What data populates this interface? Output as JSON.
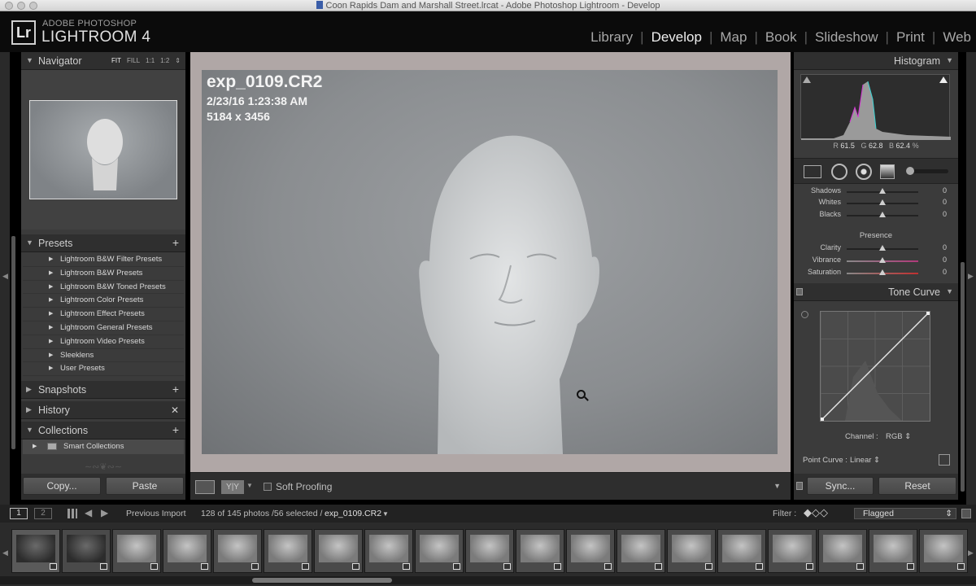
{
  "window": {
    "title": "Coon Rapids Dam and Marshall Street.lrcat - Adobe Photoshop Lightroom - Develop"
  },
  "brand": {
    "logo": "Lr",
    "line1": "ADOBE PHOTOSHOP",
    "line2": "LIGHTROOM 4"
  },
  "modules": [
    {
      "label": "Library",
      "active": false
    },
    {
      "label": "Develop",
      "active": true
    },
    {
      "label": "Map",
      "active": false
    },
    {
      "label": "Book",
      "active": false
    },
    {
      "label": "Slideshow",
      "active": false
    },
    {
      "label": "Print",
      "active": false
    },
    {
      "label": "Web",
      "active": false
    }
  ],
  "navigator": {
    "title": "Navigator",
    "zoom": [
      "FIT",
      "FILL",
      "1:1",
      "1:2"
    ]
  },
  "presets": {
    "title": "Presets",
    "items": [
      "Lightroom B&W Filter Presets",
      "Lightroom B&W Presets",
      "Lightroom B&W Toned Presets",
      "Lightroom Color Presets",
      "Lightroom Effect Presets",
      "Lightroom General Presets",
      "Lightroom Video Presets",
      "Sleeklens",
      "User Presets"
    ]
  },
  "snapshots": {
    "title": "Snapshots"
  },
  "history": {
    "title": "History"
  },
  "collections": {
    "title": "Collections",
    "smart": "Smart Collections"
  },
  "left_buttons": {
    "copy": "Copy...",
    "paste": "Paste"
  },
  "photo_info": {
    "filename": "exp_0109.CR2",
    "datetime": "2/23/16 1:23:38 AM",
    "dimensions": "5184 x 3456"
  },
  "toolbar": {
    "soft_proofing": "Soft Proofing"
  },
  "histogram": {
    "title": "Histogram",
    "r_label": "R",
    "r": "61.5",
    "g_label": "G",
    "g": "62.8",
    "b_label": "B",
    "b": "62.4",
    "unit": "%"
  },
  "basic_sliders": [
    {
      "name": "Shadows",
      "value": "0"
    },
    {
      "name": "Whites",
      "value": "0"
    },
    {
      "name": "Blacks",
      "value": "0"
    }
  ],
  "presence": {
    "title": "Presence",
    "sliders": [
      {
        "name": "Clarity",
        "value": "0"
      },
      {
        "name": "Vibrance",
        "value": "0"
      },
      {
        "name": "Saturation",
        "value": "0"
      }
    ]
  },
  "tone_curve": {
    "title": "Tone Curve",
    "channel_label": "Channel :",
    "channel": "RGB",
    "point_curve_label": "Point Curve :",
    "point_curve": "Linear"
  },
  "right_buttons": {
    "sync": "Sync...",
    "reset": "Reset"
  },
  "filmbar": {
    "page1": "1",
    "page2": "2",
    "source": "Previous Import",
    "count": "128 of 145 photos /56 selected /",
    "current": "exp_0109.CR2",
    "filter_label": "Filter :",
    "filter_value": "Flagged"
  },
  "colors": {
    "panel": "#3b3b3b",
    "header": "#0b0b0b",
    "center_bg": "#b0a7a6"
  }
}
